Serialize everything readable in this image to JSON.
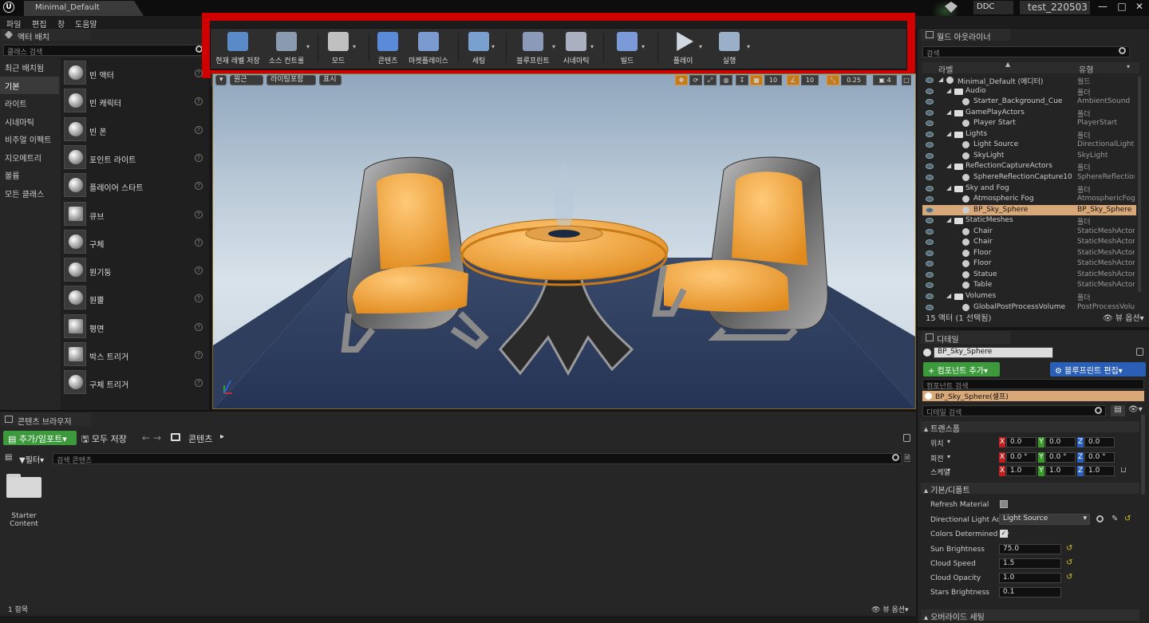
{
  "app": {
    "logo": "U",
    "level_tab": "Minimal_Default",
    "ddc": "DDC",
    "project": "test_220503",
    "window_buttons": [
      "—",
      "□",
      "✕"
    ]
  },
  "menu": [
    "파일",
    "편집",
    "창",
    "도움말"
  ],
  "left_panel": {
    "tab": "액터 배치",
    "search_placeholder": "클래스 검색",
    "categories": [
      "최근 배치됨",
      "기본",
      "라이트",
      "시네마틱",
      "비주얼 이펙트",
      "지오메트리",
      "볼륨",
      "모든 클래스"
    ],
    "selected_category": 1,
    "actors": [
      "빈 액터",
      "빈 캐릭터",
      "빈 폰",
      "포인트 라이트",
      "플레이어 스타트",
      "큐브",
      "구체",
      "원기둥",
      "원뿔",
      "평면",
      "박스 트리거",
      "구체 트리거"
    ]
  },
  "toolbar": {
    "buttons": [
      {
        "label": "현재 레벨 저장",
        "icon": "save-icon",
        "dropdown": false
      },
      {
        "label": "소스 컨트롤",
        "icon": "source-control-icon",
        "dropdown": true
      },
      {
        "label": "모드",
        "icon": "modes-icon",
        "dropdown": true
      },
      {
        "label": "콘텐츠",
        "icon": "content-icon",
        "dropdown": false
      },
      {
        "label": "마켓플레이스",
        "icon": "marketplace-icon",
        "dropdown": false
      },
      {
        "label": "세팅",
        "icon": "settings-icon",
        "dropdown": true
      },
      {
        "label": "블루프린트",
        "icon": "blueprint-icon",
        "dropdown": true
      },
      {
        "label": "시네마틱",
        "icon": "cinematics-icon",
        "dropdown": true
      },
      {
        "label": "빌드",
        "icon": "build-icon",
        "dropdown": true
      },
      {
        "label": "플레이",
        "icon": "play-icon",
        "dropdown": true
      },
      {
        "label": "실행",
        "icon": "launch-icon",
        "dropdown": true
      }
    ]
  },
  "viewport": {
    "perspective": "원근",
    "lighting": "라이팅포함",
    "show": "표시",
    "snap_grid": "10",
    "snap_rotate": "10",
    "snap_scale": "0.25",
    "camera_speed": "4"
  },
  "outliner": {
    "tab": "월드 아웃라이너",
    "search_placeholder": "검색",
    "col_label": "라벨",
    "col_type": "유형",
    "rows": [
      {
        "name": "Minimal_Default (에디터)",
        "type": "월드",
        "indent": 0,
        "kind": "world"
      },
      {
        "name": "Audio",
        "type": "폴더",
        "indent": 1,
        "kind": "folder"
      },
      {
        "name": "Starter_Background_Cue",
        "type": "AmbientSound",
        "indent": 2,
        "kind": "actor"
      },
      {
        "name": "GamePlayActors",
        "type": "폴더",
        "indent": 1,
        "kind": "folder"
      },
      {
        "name": "Player Start",
        "type": "PlayerStart",
        "indent": 2,
        "kind": "actor"
      },
      {
        "name": "Lights",
        "type": "폴더",
        "indent": 1,
        "kind": "folder"
      },
      {
        "name": "Light Source",
        "type": "DirectionalLight",
        "indent": 2,
        "kind": "actor"
      },
      {
        "name": "SkyLight",
        "type": "SkyLight",
        "indent": 2,
        "kind": "actor"
      },
      {
        "name": "ReflectionCaptureActors",
        "type": "폴더",
        "indent": 1,
        "kind": "folder"
      },
      {
        "name": "SphereReflectionCapture10",
        "type": "SphereReflectionC",
        "indent": 2,
        "kind": "actor"
      },
      {
        "name": "Sky and Fog",
        "type": "폴더",
        "indent": 1,
        "kind": "folder"
      },
      {
        "name": "Atmospheric Fog",
        "type": "AtmosphericFog",
        "indent": 2,
        "kind": "actor"
      },
      {
        "name": "BP_Sky_Sphere",
        "type": "BP_Sky_Sphere",
        "indent": 2,
        "kind": "actor",
        "selected": true
      },
      {
        "name": "StaticMeshes",
        "type": "폴더",
        "indent": 1,
        "kind": "folder"
      },
      {
        "name": "Chair",
        "type": "StaticMeshActor",
        "indent": 2,
        "kind": "actor"
      },
      {
        "name": "Chair",
        "type": "StaticMeshActor",
        "indent": 2,
        "kind": "actor"
      },
      {
        "name": "Floor",
        "type": "StaticMeshActor",
        "indent": 2,
        "kind": "actor"
      },
      {
        "name": "Floor",
        "type": "StaticMeshActor",
        "indent": 2,
        "kind": "actor"
      },
      {
        "name": "Statue",
        "type": "StaticMeshActor",
        "indent": 2,
        "kind": "actor"
      },
      {
        "name": "Table",
        "type": "StaticMeshActor",
        "indent": 2,
        "kind": "actor"
      },
      {
        "name": "Volumes",
        "type": "폴더",
        "indent": 1,
        "kind": "folder"
      },
      {
        "name": "GlobalPostProcessVolume",
        "type": "PostProcessVolu",
        "indent": 2,
        "kind": "actor"
      }
    ],
    "footer": "15 액터 (1 선택됨)",
    "view_options": "뷰 옵션"
  },
  "details": {
    "tab": "디테일",
    "actor_name": "BP_Sky_Sphere",
    "add_component": "+ 컴포넌트 추가",
    "edit_blueprint": "블루프린트 편집",
    "component_search_placeholder": "컴포넌트 검색",
    "component_self": "BP_Sky_Sphere(셀프)",
    "detail_search_placeholder": "디테일 검색",
    "transform_header": "트랜스폼",
    "location_label": "위치",
    "rotation_label": "회전",
    "scale_label": "스케일",
    "location": [
      "0.0",
      "0.0",
      "0.0"
    ],
    "rotation": [
      "0.0 °",
      "0.0 °",
      "0.0 °"
    ],
    "scale": [
      "1.0",
      "1.0",
      "1.0"
    ],
    "axis_labels": [
      "X",
      "Y",
      "Z"
    ],
    "default_header": "기본/디폴트",
    "refresh_material": "Refresh Material",
    "directional_light_actor": "Directional Light Actor",
    "directional_light_value": "Light Source",
    "colors_determined_by": "Colors Determined By",
    "sun_brightness_label": "Sun Brightness",
    "sun_brightness": "75.0",
    "cloud_speed_label": "Cloud Speed",
    "cloud_speed": "1.5",
    "cloud_opacity_label": "Cloud Opacity",
    "cloud_opacity": "1.0",
    "stars_brightness_label": "Stars Brightness",
    "stars_brightness": "0.1",
    "override_header": "오버라이드 세팅"
  },
  "content_browser": {
    "tab": "콘텐츠 브라우저",
    "add_import": "추가/임포트",
    "save_all": "모두 저장",
    "path": "콘텐츠",
    "filters": "필터",
    "search_placeholder": "검색 콘텐츠",
    "folder_line1": "Starter",
    "folder_line2": "Content",
    "count": "1 항목",
    "view_options": "뷰 옵션"
  },
  "colors": {
    "accent_red": "#d10000",
    "selection": "#d9a878",
    "green": "#3c9a3c",
    "blue": "#2a5fb5",
    "axis_x": "#c02020",
    "axis_y": "#3a9a2a",
    "axis_z": "#2a5fc0"
  }
}
